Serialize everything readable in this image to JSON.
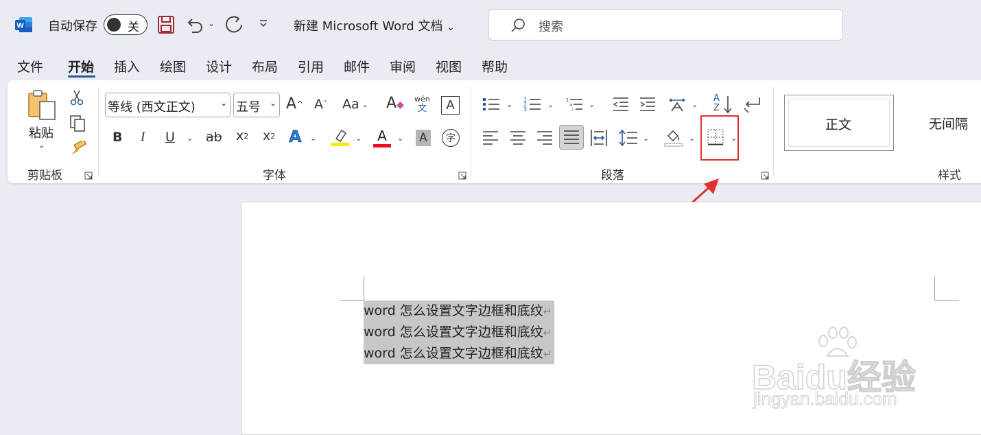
{
  "titlebar": {
    "autosave_label": "自动保存",
    "autosave_state": "关",
    "doc_title": "新建 Microsoft Word 文档",
    "search_placeholder": "搜索"
  },
  "menu": {
    "tabs": [
      "文件",
      "开始",
      "插入",
      "绘图",
      "设计",
      "布局",
      "引用",
      "邮件",
      "审阅",
      "视图",
      "帮助"
    ],
    "active": "开始"
  },
  "ribbon": {
    "clipboard": {
      "paste_label": "粘贴",
      "group_label": "剪贴板"
    },
    "font": {
      "font_name": "等线 (西文正文)",
      "font_size": "五号",
      "grow": "A",
      "shrink": "A",
      "case": "Aa",
      "phonetic_top": "wén",
      "phonetic_bottom": "文",
      "bold": "B",
      "italic": "I",
      "underline": "U",
      "strike": "ab",
      "subscript": "x",
      "sub_mark": "2",
      "superscript": "x",
      "sup_mark": "2",
      "text_effect": "A",
      "font_color": "A",
      "char_shading": "A",
      "enclose": "字",
      "group_label": "字体"
    },
    "paragraph": {
      "group_label": "段落",
      "sort_a": "A",
      "sort_z": "Z"
    },
    "styles": {
      "items": [
        "正文",
        "无间隔"
      ],
      "group_label": "样式"
    }
  },
  "document": {
    "lines": [
      "word 怎么设置文字边框和底纹",
      "word 怎么设置文字边框和底纹",
      "word 怎么设置文字边框和底纹"
    ],
    "paragraph_mark": "↵"
  },
  "watermark": {
    "logo_text": "Baidu经验",
    "url": "jingyan.baidu.com"
  },
  "colors": {
    "accent": "#2b579a",
    "highlight": "#ffe800",
    "font_color": "#e81123",
    "annotation": "#e03030"
  }
}
